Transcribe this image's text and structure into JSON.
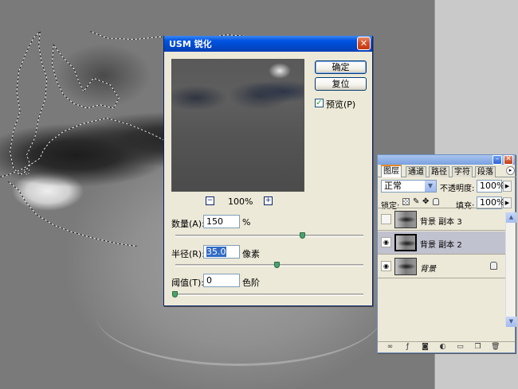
{
  "dialog": {
    "title": "USM 锐化",
    "ok_label": "确定",
    "reset_label": "复位",
    "preview_label": "预览(P)",
    "preview_checked": true,
    "zoom": "100%",
    "zoom_out": "−",
    "zoom_in": "+",
    "amount_label": "数量(A):",
    "amount_value": "150",
    "amount_unit": "%",
    "radius_label": "半径(R):",
    "radius_value": "35.0",
    "radius_unit": "像素",
    "threshold_label": "阈值(T):",
    "threshold_value": "0",
    "threshold_unit": "色阶",
    "close_glyph": "✕"
  },
  "layers_panel": {
    "tabs": [
      "图层",
      "通道",
      "路径",
      "字符",
      "段落"
    ],
    "active_tab": 0,
    "blend_mode": "正常",
    "opacity_label": "不透明度:",
    "opacity_value": "100%",
    "lock_label": "锁定:",
    "fill_label": "填充:",
    "fill_value": "100%",
    "layers": [
      {
        "name": "背景 副本 3",
        "visible": false,
        "selected": false
      },
      {
        "name": "背景 副本 2",
        "visible": true,
        "selected": true
      },
      {
        "name": "背景",
        "visible": true,
        "selected": false,
        "locked": true
      }
    ],
    "menu_glyph": "▸",
    "close_glyph": "✕",
    "min_glyph": "–"
  },
  "colors": {
    "title_bar": "#0054e3",
    "close_button": "#d8481c",
    "dialog_bg": "#ece9d8",
    "selected_layer": "#c1c2cf"
  }
}
